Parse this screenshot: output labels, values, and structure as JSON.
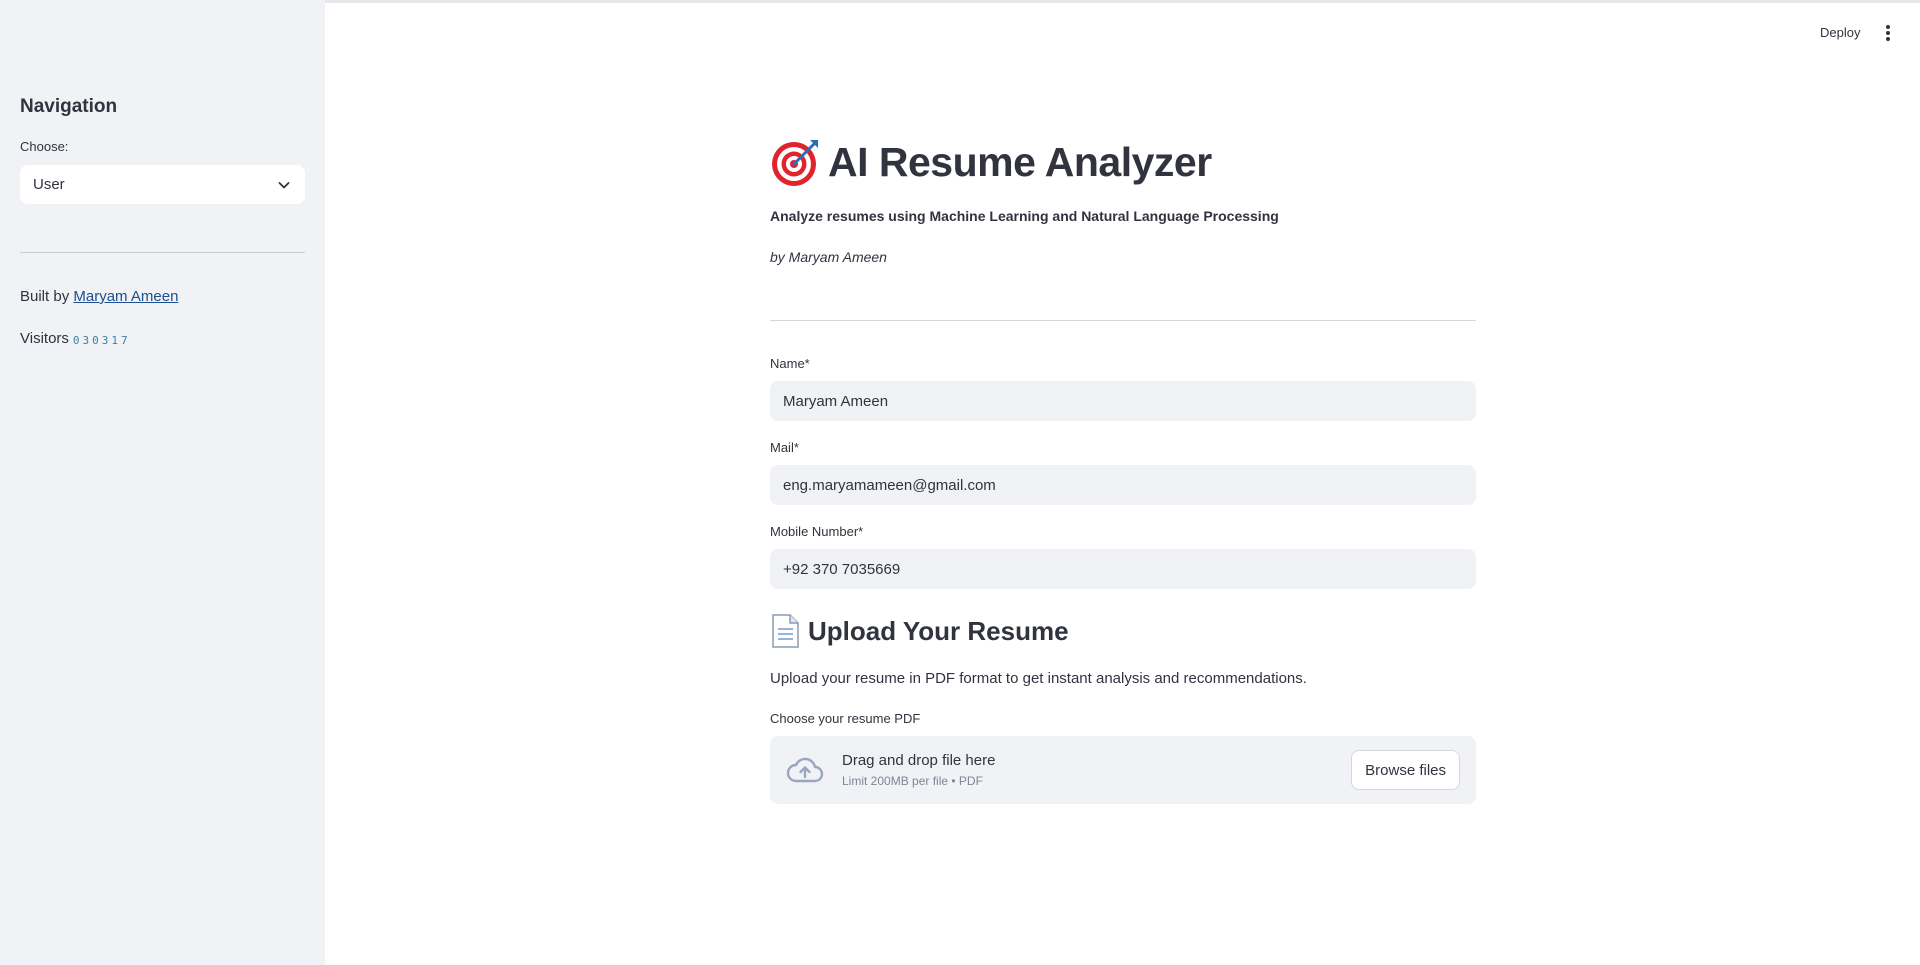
{
  "header": {
    "deploy_label": "Deploy",
    "menu_icon": "kebab-menu-icon"
  },
  "sidebar": {
    "title": "Navigation",
    "select_label": "Choose:",
    "select_value": "User",
    "built_prefix": "Built by",
    "built_link": "Maryam Ameen",
    "visitors_label": "Visitors",
    "visitors_count": "030317"
  },
  "main": {
    "title_icon": "target-emoji",
    "title": "AI Resume Analyzer",
    "subtitle": "Analyze resumes using Machine Learning and Natural Language Processing",
    "byline": "by Maryam Ameen",
    "form": {
      "name_label": "Name*",
      "name_value": "Maryam Ameen",
      "mail_label": "Mail*",
      "mail_value": "eng.maryamameen@gmail.com",
      "mobile_label": "Mobile Number*",
      "mobile_value": "+92 370 7035669"
    },
    "upload": {
      "icon": "document-emoji",
      "title": "Upload Your Resume",
      "description": "Upload your resume in PDF format to get instant analysis and recommendations.",
      "uploader_label": "Choose your resume PDF",
      "drop_text": "Drag and drop file here",
      "limit_text": "Limit 200MB per file • PDF",
      "browse_label": "Browse files"
    }
  },
  "colors": {
    "sidebar_bg": "#f0f2f6",
    "text": "#31333f",
    "link": "#1c4f8f",
    "input_bg": "#f0f2f6"
  }
}
